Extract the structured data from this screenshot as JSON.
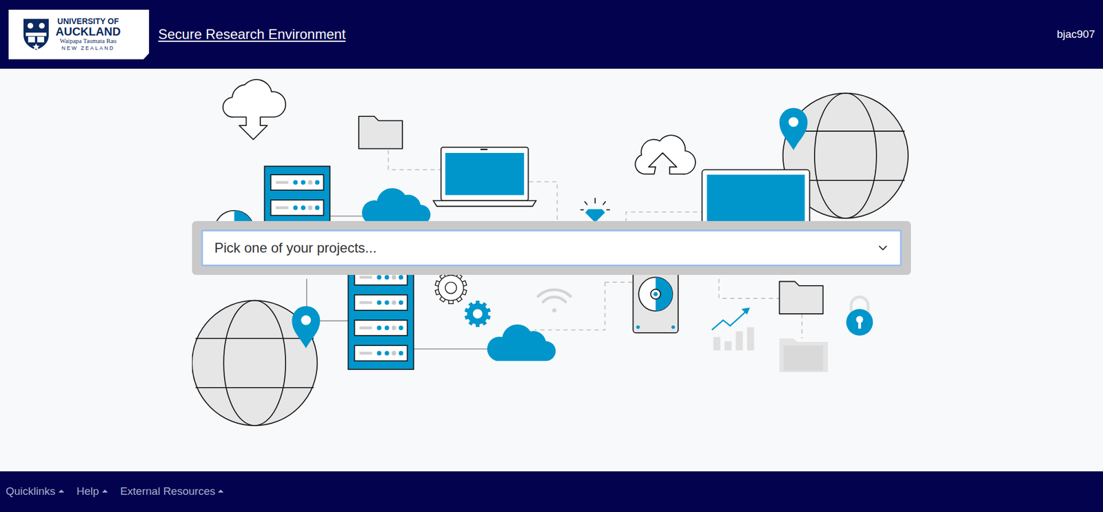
{
  "header": {
    "logo": {
      "lines": [
        "UNIVERSITY OF",
        "AUCKLAND",
        "Waipapa Taumata Rau",
        "NEW ZEALAND"
      ]
    },
    "title": "Secure Research Environment",
    "user": "bjac907"
  },
  "project_picker": {
    "placeholder": "Pick one of your projects...",
    "expanded": false
  },
  "footer": {
    "menus": [
      {
        "label": "Quicklinks"
      },
      {
        "label": "Help"
      },
      {
        "label": "External Resources"
      }
    ]
  }
}
